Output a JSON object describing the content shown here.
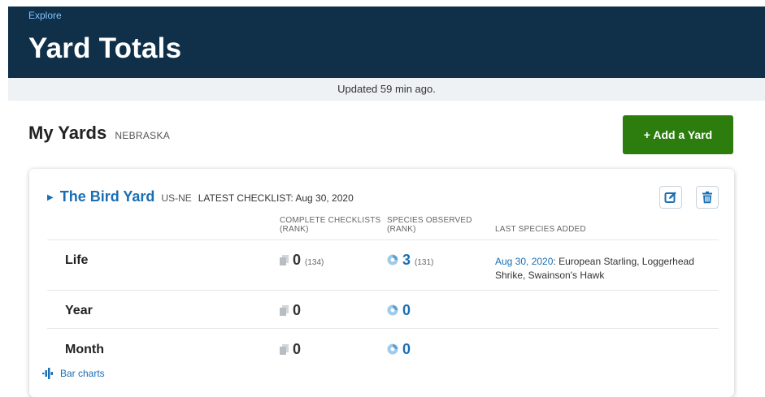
{
  "header": {
    "breadcrumb": "Explore",
    "title": "Yard Totals"
  },
  "status": {
    "updated": "Updated 59 min ago."
  },
  "section": {
    "title": "My Yards",
    "region": "NEBRASKA",
    "add_button_label": "+ Add a Yard"
  },
  "yard": {
    "name": "The Bird Yard",
    "code": "US-NE",
    "latest_checklist": "LATEST CHECKLIST: Aug 30, 2020",
    "columns": {
      "checklists_line1": "COMPLETE CHECKLISTS",
      "checklists_line2": "(RANK)",
      "species_line1": "SPECIES OBSERVED",
      "species_line2": "(RANK)",
      "last_species": "LAST SPECIES ADDED"
    },
    "rows": [
      {
        "label": "Life",
        "checklists": "0",
        "checklists_rank": "(134)",
        "species": "3",
        "species_rank": "(131)"
      },
      {
        "label": "Year",
        "checklists": "0",
        "species": "0"
      },
      {
        "label": "Month",
        "checklists": "0",
        "species": "0"
      }
    ],
    "last_species_added": {
      "date": "Aug 30, 2020",
      "species": ": European Starling, Loggerhead Shrike, Swainson's Hawk"
    },
    "bar_charts_label": "Bar charts"
  },
  "colors": {
    "header_bg": "#10304a",
    "link_blue": "#1a6eb3",
    "add_button_green": "#2c7c0e",
    "updated_bar_bg": "#eef2f5"
  },
  "icons": [
    "caret-right-icon",
    "edit-icon",
    "trash-icon",
    "checklist-icon",
    "species-icon",
    "bar-chart-icon"
  ]
}
